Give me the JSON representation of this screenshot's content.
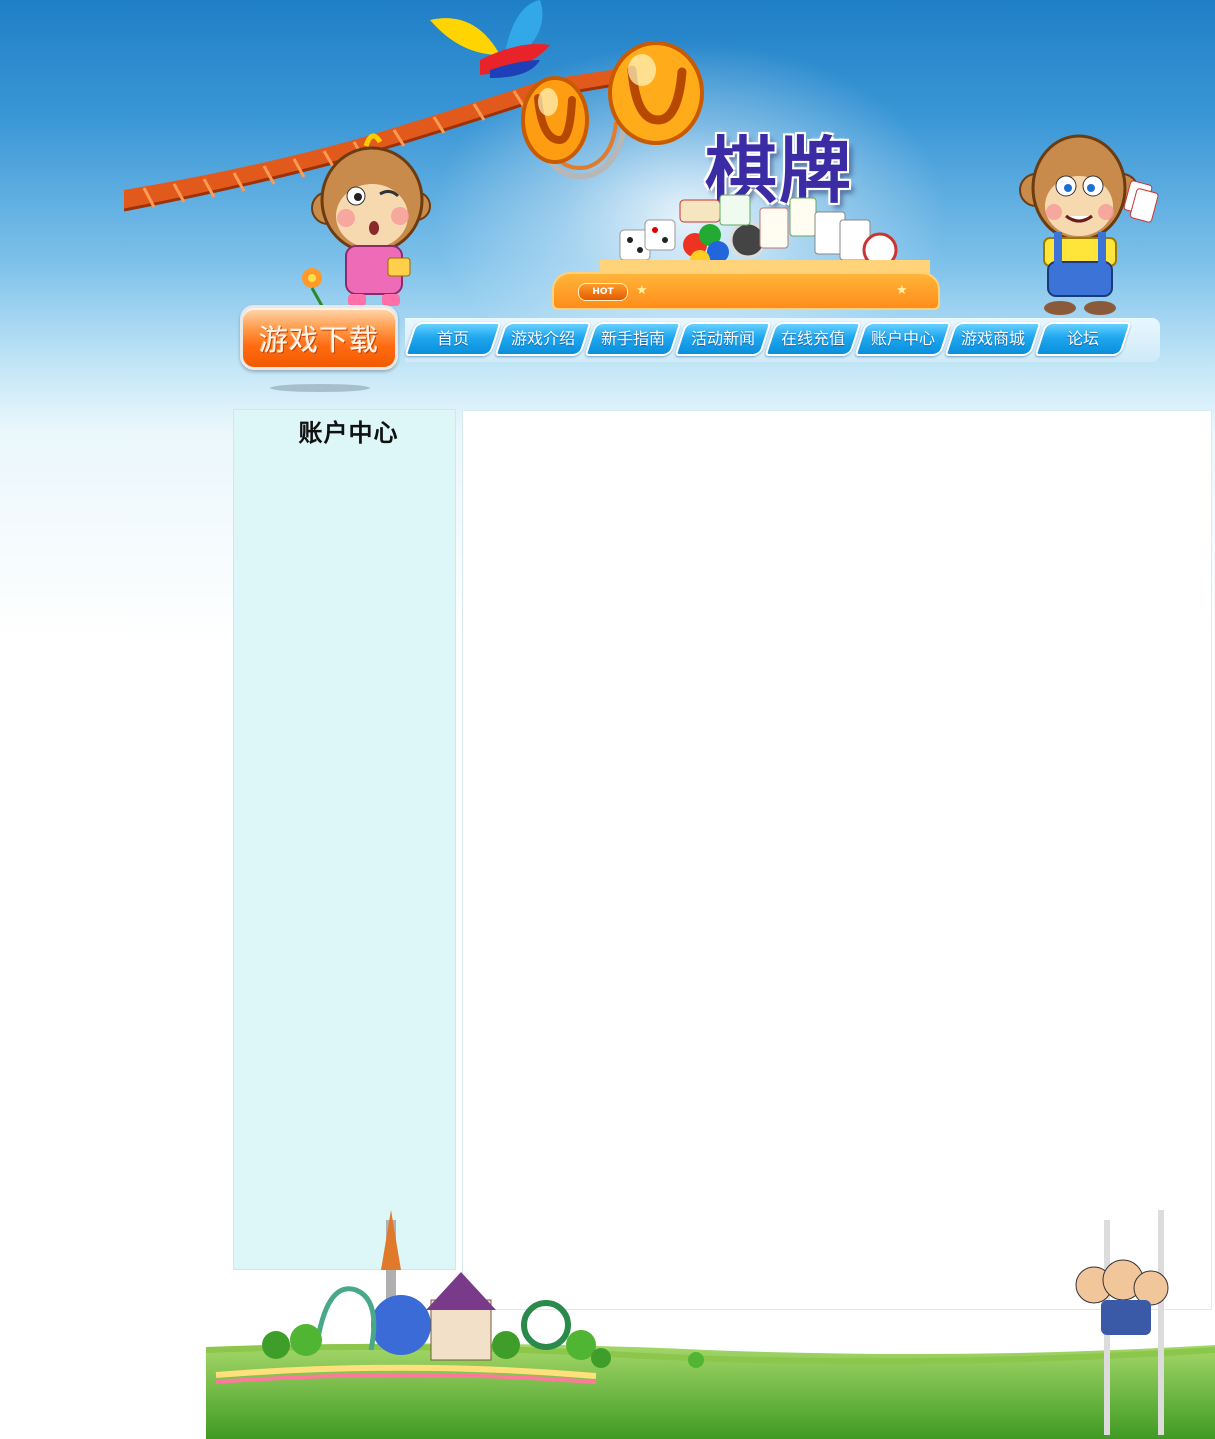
{
  "header": {
    "logo_text": "UU",
    "title": "棋牌",
    "hot_label": "HOT"
  },
  "nav": {
    "download_label": "游戏下载",
    "items": [
      {
        "label": "首页"
      },
      {
        "label": "游戏介绍"
      },
      {
        "label": "新手指南"
      },
      {
        "label": "活动新闻"
      },
      {
        "label": "在线充值"
      },
      {
        "label": "账户中心"
      },
      {
        "label": "游戏商城"
      },
      {
        "label": "论坛"
      }
    ]
  },
  "sidebar": {
    "title": "账户中心"
  },
  "colors": {
    "sky_top": "#1f7fc6",
    "nav_blue": "#1ea7ef",
    "download_orange": "#ff6a10",
    "sidebar_bg": "#ddf6f7",
    "grass": "#5fb53a"
  }
}
